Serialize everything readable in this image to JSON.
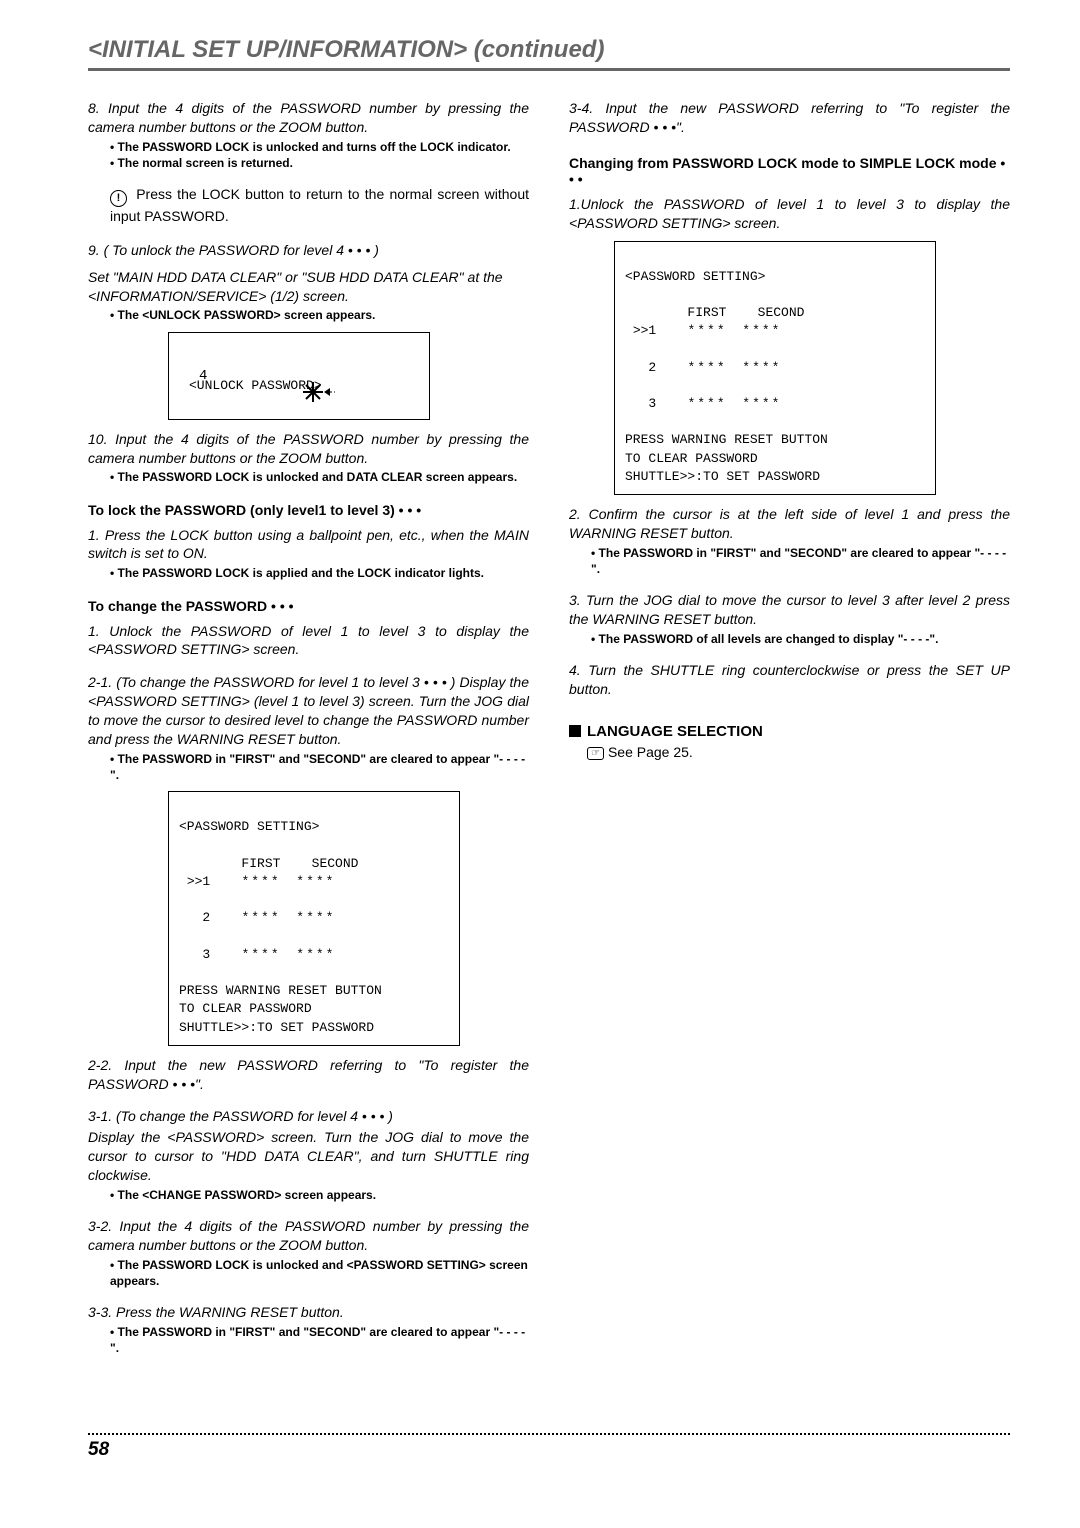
{
  "header": "<INITIAL SET UP/INFORMATION> (continued)",
  "left": {
    "step8": "8. Input the 4 digits of the PASSWORD number by pressing the camera number buttons or the ZOOM button.",
    "note8a": "• The PASSWORD LOCK is unlocked and turns off the LOCK indicator.",
    "note8b": "• The normal screen is returned.",
    "info": "Press the LOCK button to return to the normal screen without input PASSWORD.",
    "step9": "9. ( To unlock the PASSWORD for level 4 • • • )",
    "step9b": "Set \"MAIN HDD DATA CLEAR\" or \"SUB HDD DATA CLEAR\" at the <INFORMATION/SERVICE> (1/2) screen.",
    "note9": "• The <UNLOCK PASSWORD> screen appears.",
    "unlock_title": "<UNLOCK PASSWORD>",
    "unlock_row": "4",
    "step10": "10. Input the 4 digits of the PASSWORD number by pressing the camera number buttons or the ZOOM button.",
    "note10": "• The PASSWORD LOCK is unlocked and DATA CLEAR screen appears.",
    "lockhead": "To lock the PASSWORD (only level1 to level 3) • • •",
    "lock1": "1. Press the LOCK button using a ballpoint pen, etc., when the MAIN switch is set to ON.",
    "locknote": "• The PASSWORD LOCK is applied and the LOCK indicator lights.",
    "changehead": "To change the PASSWORD • • •",
    "change1": "1. Unlock the PASSWORD of level 1 to level 3 to display the <PASSWORD SETTING> screen.",
    "change21": "2-1. (To change the PASSWORD for level 1 to level 3 • • • ) Display the <PASSWORD SETTING> (level 1 to level 3) screen. Turn the JOG dial to move the cursor to desired level to change the PASSWORD number and press the WARNING RESET button.",
    "note21": "• The PASSWORD in \"FIRST\" and \"SECOND\" are cleared to appear \"- - - -\".",
    "panel_title": "<PASSWORD SETTING>",
    "panel_h1": "FIRST",
    "panel_h2": "SECOND",
    "panel_row1_pre": ">>1",
    "panel_row2_pre": "  2",
    "panel_row3_pre": "  3",
    "panel_stars": "****",
    "panel_msg1": "PRESS WARNING RESET BUTTON",
    "panel_msg2": "TO CLEAR PASSWORD",
    "panel_msg3": "SHUTTLE>>:TO SET PASSWORD",
    "change22": "2-2. Input the new PASSWORD referring to \"To register the PASSWORD • • •\".",
    "change31": "3-1. (To change the PASSWORD for level 4 • • • )",
    "change31b": "Display the <PASSWORD> screen. Turn the JOG dial to move the cursor to cursor to \"HDD DATA CLEAR\", and turn SHUTTLE ring clockwise.",
    "note31": "• The <CHANGE PASSWORD> screen appears.",
    "change32": "3-2. Input the 4 digits of the PASSWORD number by pressing the camera number buttons or the ZOOM button.",
    "note32": "• The PASSWORD LOCK is unlocked and <PASSWORD SETTING> screen appears.",
    "change33": "3-3. Press the WARNING RESET button.",
    "note33": "• The PASSWORD in \"FIRST\" and \"SECOND\" are cleared to appear \"- - - -\"."
  },
  "right": {
    "step34": "3-4. Input the new PASSWORD referring to \"To register the PASSWORD • • •\".",
    "subhead": "Changing from PASSWORD LOCK mode to SIMPLE LOCK mode • • •",
    "r1": "1.Unlock the PASSWORD of level 1 to level 3 to display the <PASSWORD SETTING> screen.",
    "panel_title": "<PASSWORD SETTING>",
    "r2": "2. Confirm the cursor is at the left side of level 1 and press the WARNING RESET button.",
    "note2": "• The PASSWORD in \"FIRST\" and \"SECOND\" are cleared to appear \"- - - -\".",
    "r3": "3. Turn the JOG dial to move the cursor to level 3 after level 2 press the WARNING RESET button.",
    "note3": "• The PASSWORD of all levels are changed to display \"- - - -\".",
    "r4": "4. Turn the SHUTTLE ring counterclockwise or press the SET UP button.",
    "langhead": "LANGUAGE SELECTION",
    "see": "See Page 25."
  },
  "pageno": "58"
}
